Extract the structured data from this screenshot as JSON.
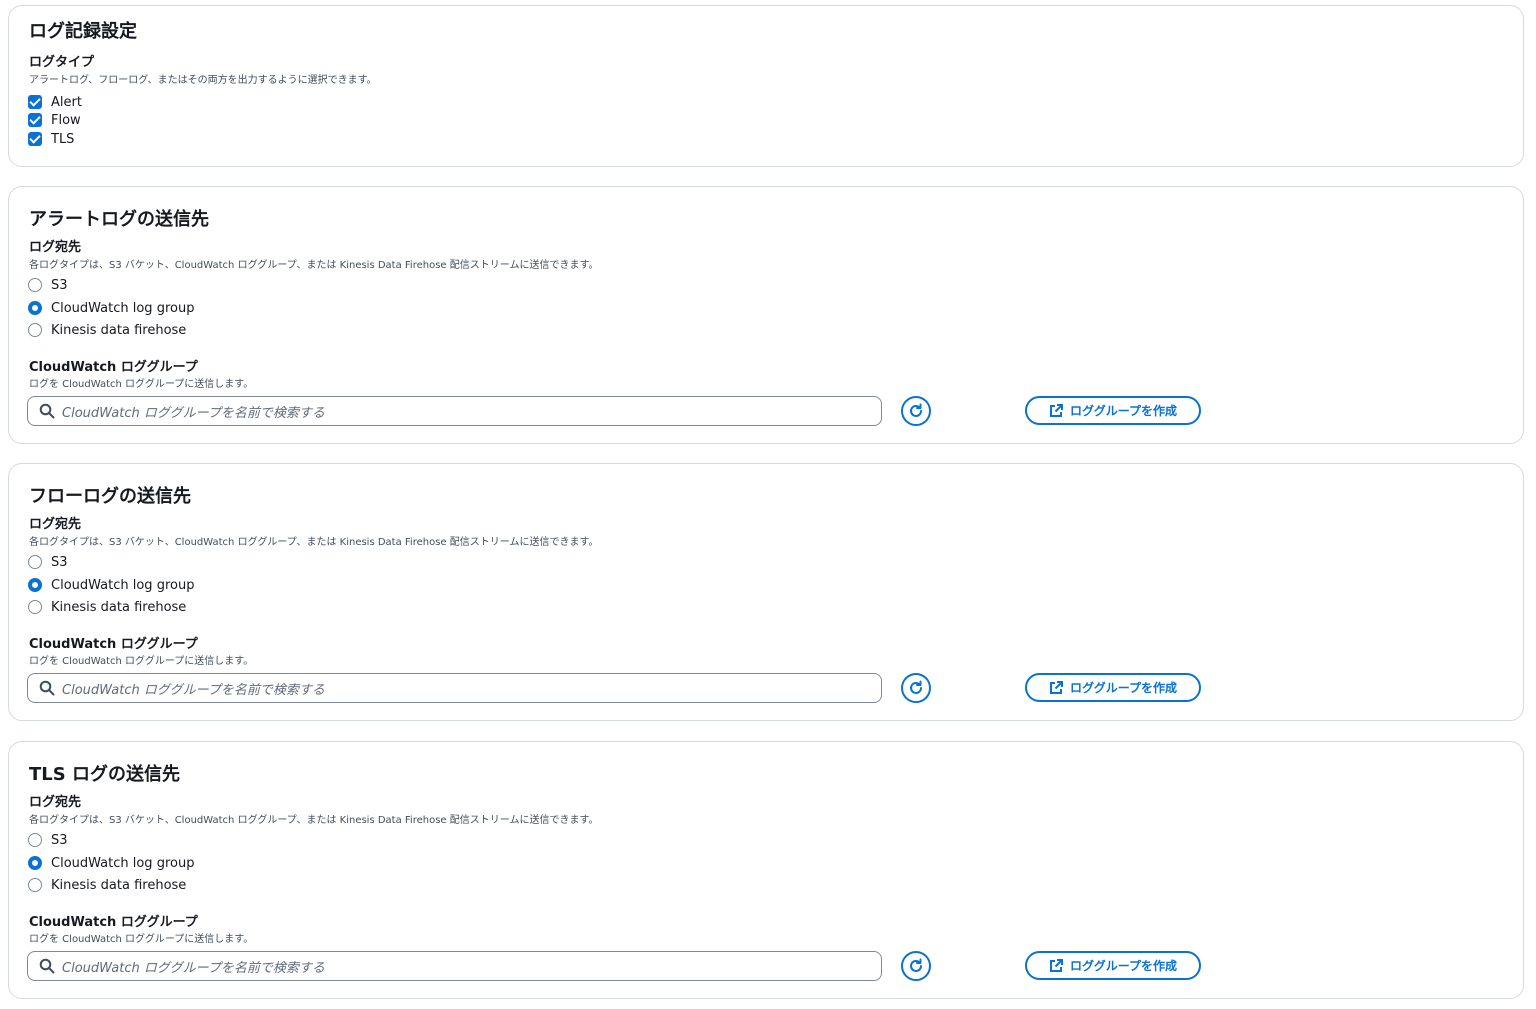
{
  "logging": {
    "title": "ログ記録設定",
    "log_type_label": "ログタイプ",
    "log_type_desc": "アラートログ、フローログ、またはその両方を出力するように選択できます。",
    "types": [
      {
        "label": "Alert",
        "checked": true
      },
      {
        "label": "Flow",
        "checked": true
      },
      {
        "label": "TLS",
        "checked": true
      }
    ]
  },
  "destinations": [
    {
      "title": "アラートログの送信先",
      "dest_label": "ログ宛先",
      "dest_desc": "各ログタイプは、S3 バケット、CloudWatch ロググループ、または Kinesis Data Firehose 配信ストリームに送信できます。",
      "options": [
        "S3",
        "CloudWatch log group",
        "Kinesis data firehose"
      ],
      "selected": "CloudWatch log group",
      "group_label": "CloudWatch ロググループ",
      "group_desc": "ログを CloudWatch ロググループに送信します。",
      "search_placeholder": "CloudWatch ロググループを名前で検索する",
      "create_button": "ロググループを作成"
    },
    {
      "title": "フローログの送信先",
      "dest_label": "ログ宛先",
      "dest_desc": "各ログタイプは、S3 バケット、CloudWatch ロググループ、または Kinesis Data Firehose 配信ストリームに送信できます。",
      "options": [
        "S3",
        "CloudWatch log group",
        "Kinesis data firehose"
      ],
      "selected": "CloudWatch log group",
      "group_label": "CloudWatch ロググループ",
      "group_desc": "ログを CloudWatch ロググループに送信します。",
      "search_placeholder": "CloudWatch ロググループを名前で検索する",
      "create_button": "ロググループを作成"
    },
    {
      "title": "TLS ログの送信先",
      "dest_label": "ログ宛先",
      "dest_desc": "各ログタイプは、S3 バケット、CloudWatch ロググループ、または Kinesis Data Firehose 配信ストリームに送信できます。",
      "options": [
        "S3",
        "CloudWatch log group",
        "Kinesis data firehose"
      ],
      "selected": "CloudWatch log group",
      "group_label": "CloudWatch ロググループ",
      "group_desc": "ログを CloudWatch ロググループに送信します。",
      "search_placeholder": "CloudWatch ロググループを名前で検索する",
      "create_button": "ロググループを作成"
    }
  ],
  "colors": {
    "accent": "#0972d3",
    "border": "#d5dbdb",
    "text": "#16191f",
    "muted": "#414d5c"
  },
  "icons": {
    "search": "search-icon",
    "refresh": "refresh-icon",
    "external": "external-link-icon"
  }
}
